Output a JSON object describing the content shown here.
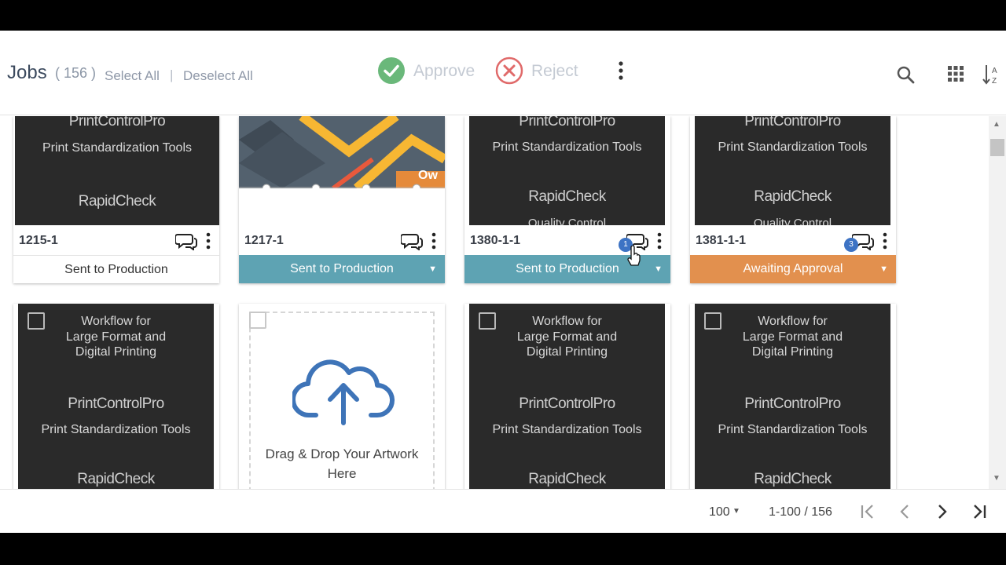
{
  "toolbar": {
    "title": "Jobs",
    "count": "( 156 )",
    "select_all": "Select All",
    "separator": "|",
    "deselect_all": "Deselect All",
    "approve_label": "Approve",
    "reject_label": "Reject"
  },
  "thumb_text": {
    "brand_printcontrol": "PrintControlPro",
    "tagline": "Print Standardization Tools",
    "brand_rapidcheck": "RapidCheck",
    "quality": "Quality Control",
    "workflow_line1": "Workflow for",
    "workflow_line2": "Large Format and",
    "workflow_line3": "Digital Printing",
    "own_fragment": "Ow"
  },
  "jobs": [
    {
      "number": "1215-1",
      "status": "Sent to Production",
      "status_style": "plain",
      "badge": ""
    },
    {
      "number": "1217-1",
      "status": "Sent to Production",
      "status_style": "teal",
      "badge": ""
    },
    {
      "number": "1380-1-1",
      "status": "Sent to Production",
      "status_style": "teal",
      "badge": "1"
    },
    {
      "number": "1381-1-1",
      "status": "Awaiting Approval",
      "status_style": "orange",
      "badge": "3"
    }
  ],
  "dropzone": {
    "line1": "Drag & Drop Your Artwork",
    "line2": "Here"
  },
  "pagination": {
    "page_size": "100",
    "range": "1-100 / 156"
  },
  "colors": {
    "teal": "#5ea3b3",
    "orange": "#e2904e",
    "approve_green": "#6ab87a",
    "reject_red": "#e06a6a",
    "badge_blue": "#3d73c4",
    "upload_blue": "#3e74b8"
  },
  "icons": [
    "approve-check-icon",
    "reject-x-icon",
    "more-vertical-icon",
    "search-icon",
    "grid-view-icon",
    "sort-az-icon",
    "chat-icon",
    "cloud-upload-icon",
    "first-page-icon",
    "prev-page-icon",
    "next-page-icon",
    "last-page-icon"
  ]
}
